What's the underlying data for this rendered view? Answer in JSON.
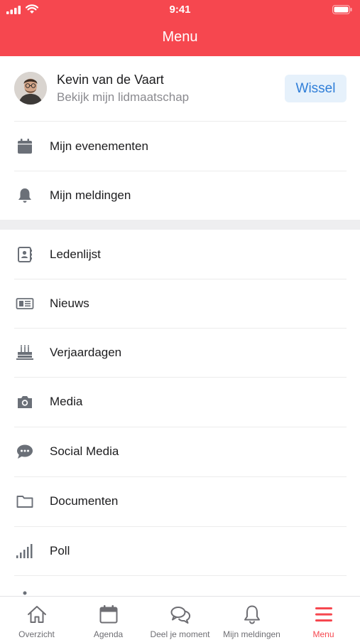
{
  "status_bar": {
    "time": "9:41"
  },
  "header": {
    "title": "Menu"
  },
  "profile": {
    "name": "Kevin van de Vaart",
    "subtitle": "Bekijk mijn lidmaatschap",
    "switch_label": "Wissel"
  },
  "menu_group_1": [
    {
      "label": "Mijn evenementen",
      "icon": "calendar-icon"
    },
    {
      "label": "Mijn meldingen",
      "icon": "bell-icon"
    }
  ],
  "menu_group_2": [
    {
      "label": "Ledenlijst",
      "icon": "contacts-icon"
    },
    {
      "label": "Nieuws",
      "icon": "newspaper-icon"
    },
    {
      "label": "Verjaardagen",
      "icon": "birthday-cake-icon"
    },
    {
      "label": "Media",
      "icon": "camera-icon"
    },
    {
      "label": "Social Media",
      "icon": "chat-bubble-icon"
    },
    {
      "label": "Documenten",
      "icon": "folder-icon"
    },
    {
      "label": "Poll",
      "icon": "bar-signal-icon"
    }
  ],
  "tabbar": [
    {
      "label": "Overzicht",
      "icon": "home-icon",
      "active": false
    },
    {
      "label": "Agenda",
      "icon": "calendar-icon",
      "active": false
    },
    {
      "label": "Deel je moment",
      "icon": "chat-bubbles-icon",
      "active": false
    },
    {
      "label": "Mijn meldingen",
      "icon": "bell-icon",
      "active": false
    },
    {
      "label": "Menu",
      "icon": "hamburger-icon",
      "active": true
    }
  ],
  "colors": {
    "brand_red": "#f6474f",
    "switch_bg": "#e6f1fb",
    "switch_text": "#2f7ed8",
    "icon_gray": "#6b7078"
  }
}
